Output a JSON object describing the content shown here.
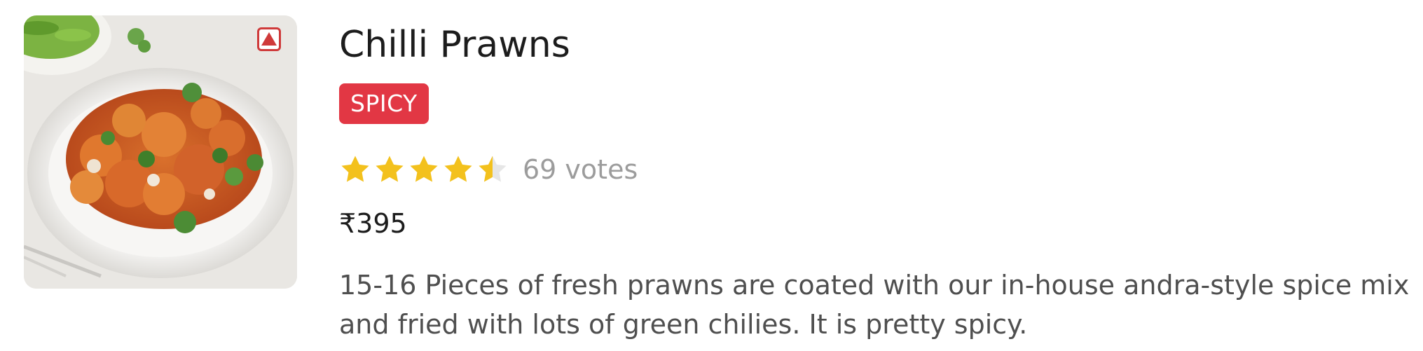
{
  "dish": {
    "image_alt": "Chilli Prawns dish photo",
    "nonveg_indicator": "non-veg-indicator-icon",
    "name": "Chilli Prawns",
    "tag": "SPICY",
    "rating": 4.5,
    "rating_max": 5,
    "votes_text": "69 votes",
    "price": "₹395",
    "description": "15-16 Pieces of fresh prawns are coated with our in-house andra-style spice mix and fried with lots of green chilies. It is pretty spicy."
  },
  "colors": {
    "tag_background": "#e23744",
    "star_filled": "#f3c11d",
    "star_empty": "#e6e6e6",
    "nonveg_indicator": "#cf3a3a",
    "votes_text": "#9c9c9c"
  }
}
